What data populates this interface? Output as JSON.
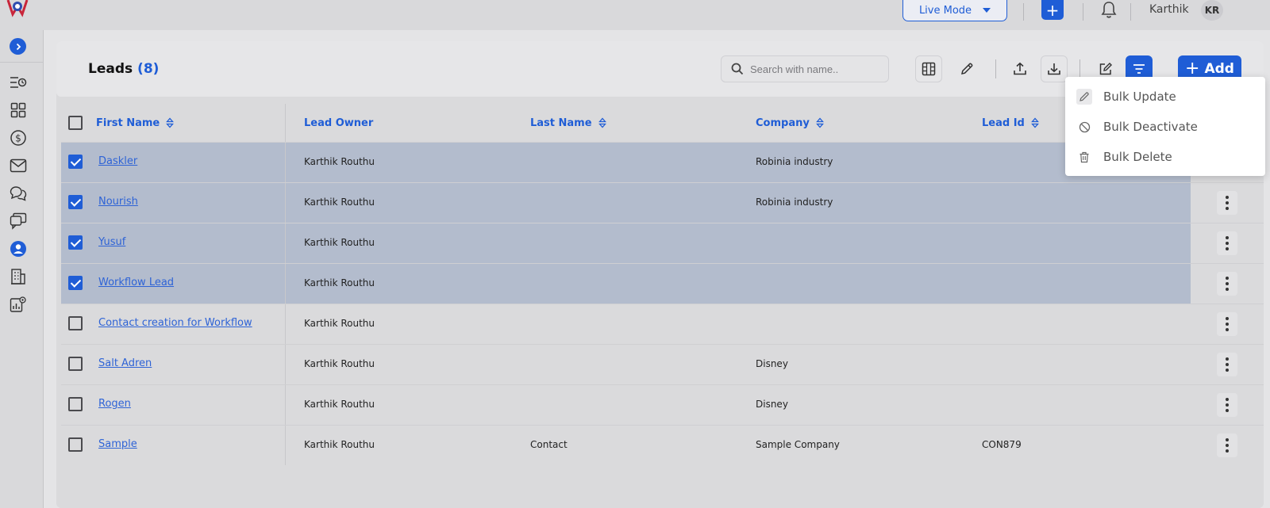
{
  "topbar": {
    "mode_label": "Live Mode",
    "user_name": "Karthik",
    "user_initials": "KR"
  },
  "page": {
    "title": "Leads",
    "count": "(8)",
    "search_placeholder": "Search with name..",
    "add_label": "Add"
  },
  "table": {
    "columns": {
      "first_name": "First Name",
      "lead_owner": "Lead Owner",
      "last_name": "Last Name",
      "company": "Company",
      "lead_id": "Lead Id"
    },
    "rows": [
      {
        "first_name": "Daskler",
        "lead_owner": "Karthik Routhu",
        "last_name": "",
        "company": "Robinia industry",
        "lead_id": "",
        "selected": true
      },
      {
        "first_name": "Nourish",
        "lead_owner": "Karthik Routhu",
        "last_name": "",
        "company": "Robinia industry",
        "lead_id": "",
        "selected": true
      },
      {
        "first_name": "Yusuf",
        "lead_owner": "Karthik Routhu",
        "last_name": "",
        "company": "",
        "lead_id": "",
        "selected": true
      },
      {
        "first_name": "Workflow Lead",
        "lead_owner": "Karthik Routhu",
        "last_name": "",
        "company": "",
        "lead_id": "",
        "selected": true
      },
      {
        "first_name": "Contact creation for Workflow",
        "lead_owner": "Karthik Routhu",
        "last_name": "",
        "company": "",
        "lead_id": "",
        "selected": false
      },
      {
        "first_name": "Salt Adren",
        "lead_owner": "Karthik Routhu",
        "last_name": "",
        "company": "Disney",
        "lead_id": "",
        "selected": false
      },
      {
        "first_name": "Rogen",
        "lead_owner": "Karthik Routhu",
        "last_name": "",
        "company": "Disney",
        "lead_id": "",
        "selected": false
      },
      {
        "first_name": "Sample",
        "lead_owner": "Karthik Routhu",
        "last_name": "Contact",
        "company": "Sample Company",
        "lead_id": "CON879",
        "selected": false
      }
    ]
  },
  "bulk_menu": {
    "items": [
      {
        "label": "Bulk Update",
        "icon": "pencil-icon"
      },
      {
        "label": "Bulk Deactivate",
        "icon": "block-icon"
      },
      {
        "label": "Bulk Delete",
        "icon": "trash-icon"
      }
    ]
  },
  "sidebar": {
    "icons": [
      "activity-list-icon",
      "dashboard-grid-icon",
      "dollar-icon",
      "mail-icon",
      "chat-icon",
      "conversations-icon",
      "contact-user-icon",
      "building-icon",
      "settings-chart-icon"
    ],
    "active_icon": "contact-user-icon"
  },
  "colors": {
    "accent": "#1f5dd6",
    "selected_row": "#b3bccd",
    "background": "#e4e4e6"
  }
}
